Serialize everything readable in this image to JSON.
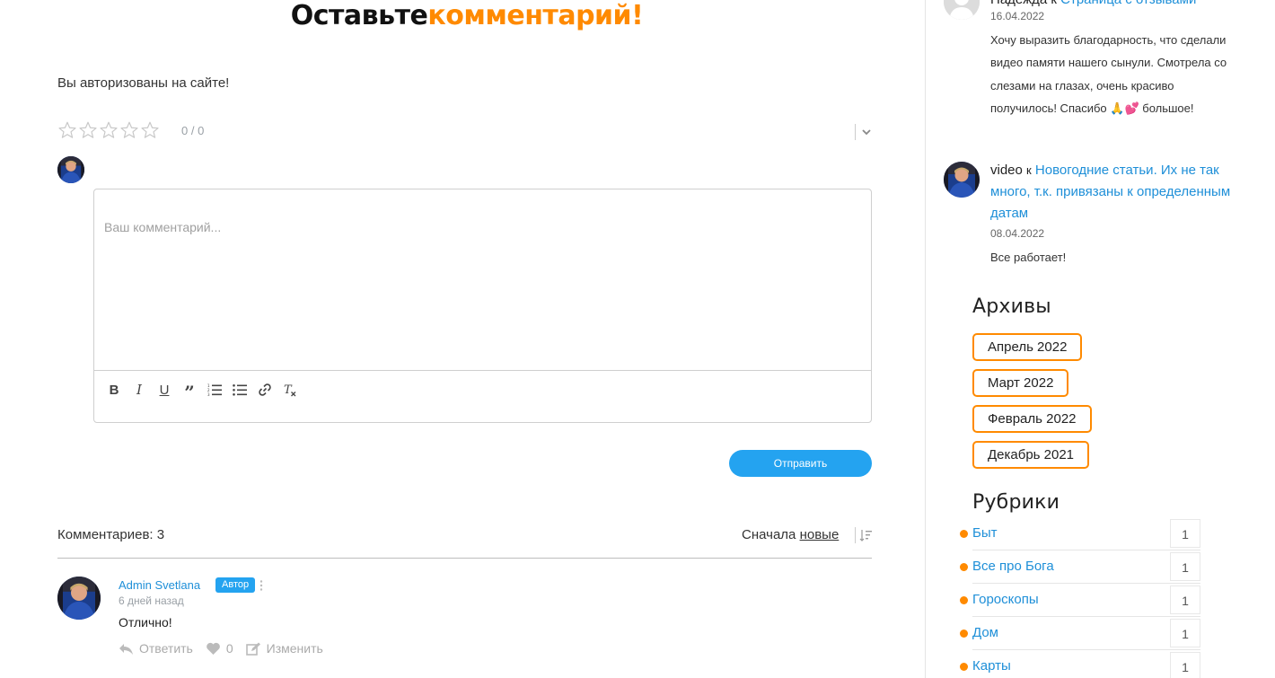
{
  "form": {
    "title_part1": "Оставьте",
    "title_part2": "комментарий!",
    "auth_note": "Вы авторизованы на сайте!",
    "rating_value": "0 / 0",
    "rating_stars": 0,
    "placeholder": "Ваш комментарий...",
    "submit_label": "Отправить",
    "toolbar": [
      "bold-icon",
      "italic-icon",
      "underline-icon",
      "quote-icon",
      "ordered-list-icon",
      "bullet-list-icon",
      "link-icon",
      "clear-format-icon"
    ]
  },
  "comments": {
    "count_label": "Комментариев: 3",
    "sort_prefix": "Сначала",
    "sort_value": "новые",
    "items": [
      {
        "author": "Admin Svetlana",
        "badge": "Автор",
        "date": "6 дней назад",
        "text": "Отлично!",
        "reply_label": "Ответить",
        "likes": "0",
        "edit_label": "Изменить"
      }
    ]
  },
  "sidebar": {
    "recent": [
      {
        "author": "Надежда",
        "to": "к",
        "post": "Страница с отзывами",
        "date": "16.04.2022",
        "text": "Хочу выразить благодарность, что сделали видео памяти нашего сынули. Смотрела со слезами на глазах, очень красиво получилось! Спасибо 🙏💕 большое!"
      },
      {
        "author": "video",
        "to": "к",
        "post": "Новогодние статьи. Их не так много, т.к. привязаны к определенным датам",
        "date": "08.04.2022",
        "text": "Все работает!"
      }
    ],
    "archives_title": "Архивы",
    "archives": [
      "Апрель 2022",
      "Март 2022",
      "Февраль 2022",
      "Декабрь 2021"
    ],
    "categories_title": "Рубрики",
    "categories": [
      {
        "label": "Быт",
        "count": "1"
      },
      {
        "label": "Все про Бога",
        "count": "1"
      },
      {
        "label": "Гороскопы",
        "count": "1"
      },
      {
        "label": "Дом",
        "count": "1"
      },
      {
        "label": "Карты",
        "count": "1"
      }
    ]
  },
  "colors": {
    "accent": "#ff8a00",
    "link": "#1e8fd8",
    "button": "#24a3f0"
  }
}
